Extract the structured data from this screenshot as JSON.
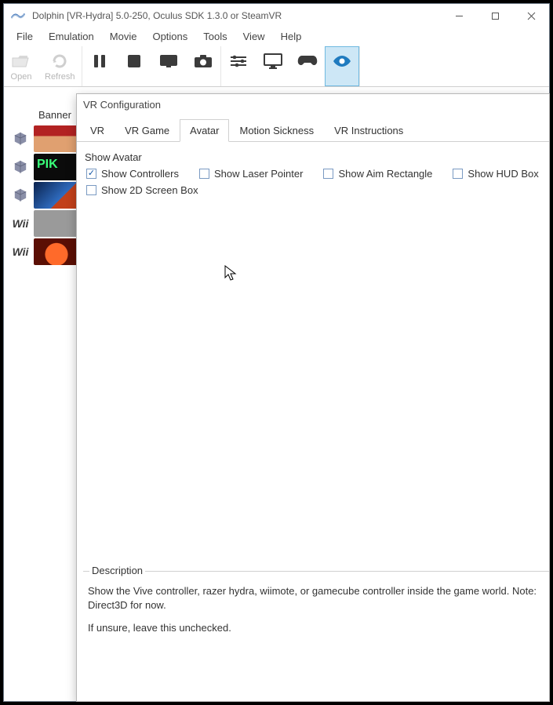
{
  "titlebar": {
    "title": "Dolphin [VR-Hydra] 5.0-250, Oculus SDK 1.3.0 or SteamVR"
  },
  "menubar": {
    "items": [
      "File",
      "Emulation",
      "Movie",
      "Options",
      "Tools",
      "View",
      "Help"
    ]
  },
  "toolbar": {
    "open": "Open",
    "refresh": "Refresh"
  },
  "gamelist": {
    "header": "Banner",
    "platforms": [
      "gc",
      "gc",
      "gc",
      "wii",
      "wii"
    ]
  },
  "childwin": {
    "title": "VR Configuration",
    "tabs": [
      "VR",
      "VR Game",
      "Avatar",
      "Motion Sickness",
      "VR Instructions"
    ],
    "active_tab_index": 2,
    "group_title": "Show Avatar",
    "checks": [
      {
        "label": "Show Controllers",
        "checked": true
      },
      {
        "label": "Show Laser Pointer",
        "checked": false
      },
      {
        "label": "Show Aim Rectangle",
        "checked": false
      },
      {
        "label": "Show HUD Box",
        "checked": false
      },
      {
        "label": "Show 2D Screen Box",
        "checked": false
      }
    ],
    "description": {
      "title": "Description",
      "body1": "Show the Vive controller, razer hydra, wiimote, or gamecube controller inside the game world. Note: Direct3D for now.",
      "body2": "If unsure, leave this unchecked."
    }
  }
}
